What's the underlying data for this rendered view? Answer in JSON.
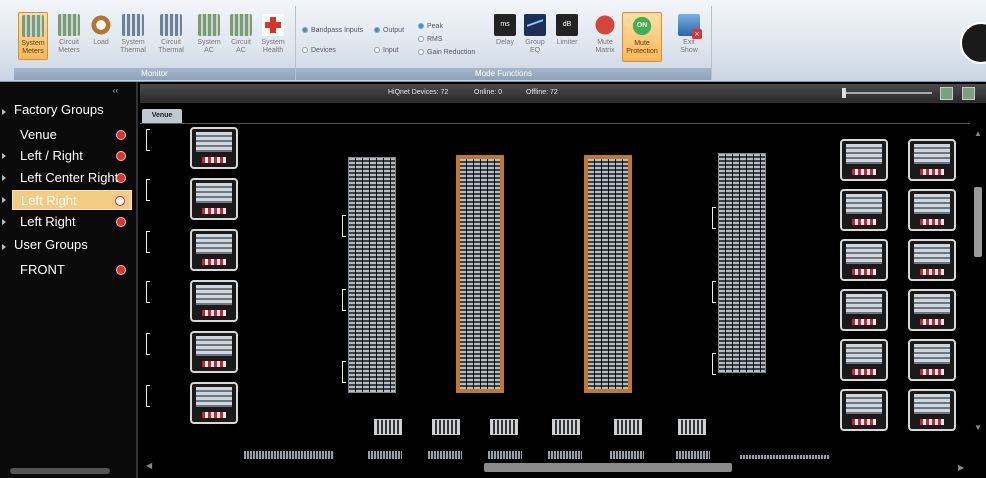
{
  "ribbon": {
    "monitor_group_label": "Monitor",
    "mode_group_label": "Mode Functions",
    "monitor_buttons": [
      {
        "label": "System Meters",
        "icon": "meter-icon",
        "active": true
      },
      {
        "label": "Circuit Meters",
        "icon": "meter-icon",
        "active": false
      },
      {
        "label": "Load",
        "icon": "load-icon",
        "active": false
      },
      {
        "label": "System Thermal",
        "icon": "thermal-icon",
        "active": false
      },
      {
        "label": "Circuit Thermal",
        "icon": "thermal-icon",
        "active": false
      },
      {
        "label": "System AC",
        "icon": "ac-icon",
        "active": false
      },
      {
        "label": "Circuit AC",
        "icon": "ac-icon",
        "active": false
      },
      {
        "label": "System Health",
        "icon": "health-icon",
        "active": false
      }
    ],
    "mode_options": {
      "bandpass_inputs": "Bandpass Inputs",
      "devices": "Devices",
      "output": "Output",
      "input": "Input",
      "peak": "Peak",
      "rms": "RMS",
      "gain_reduction": "Gain Reduction"
    },
    "mode_buttons": [
      {
        "label": "Delay",
        "icon": "delay-icon",
        "glyph": "ms"
      },
      {
        "label": "Group EQ",
        "icon": "eq-icon",
        "glyph": ""
      },
      {
        "label": "Limiter",
        "icon": "limiter-icon",
        "glyph": "dB"
      },
      {
        "label": "Mute Matrix",
        "icon": "mute-icon",
        "glyph": ""
      },
      {
        "label": "Mute Protection",
        "icon": "on-icon",
        "glyph": "ON"
      },
      {
        "label": "Exit Show",
        "icon": "exit-icon",
        "glyph": ""
      }
    ]
  },
  "status": {
    "devices": "HiQnet Devices: 72",
    "online": "Online: 0",
    "offline": "Offline: 72"
  },
  "sidebar": {
    "collapse": "‹‹",
    "factory_groups": "Factory Groups",
    "user_groups": "User Groups",
    "items": [
      {
        "label": "Venue"
      },
      {
        "label": "Left / Right"
      },
      {
        "label": "Left Center Right"
      },
      {
        "label": "Left Right"
      },
      {
        "label": "Left Right"
      }
    ],
    "user_items": [
      {
        "label": "FRONT"
      }
    ]
  },
  "canvas": {
    "tab": "Venue"
  }
}
